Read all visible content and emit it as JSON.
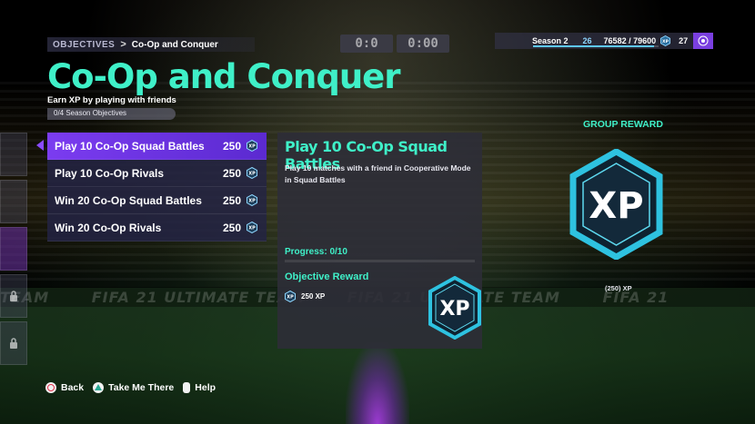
{
  "breadcrumb": {
    "parent": "OBJECTIVES",
    "separator": ">",
    "current": "Co-Op and Conquer"
  },
  "scoreboard": {
    "left_score": "0:0",
    "right_clock": "0:00"
  },
  "status": {
    "season_label": "Season 2",
    "season_level": "26",
    "xp_total": "76582 / 79600",
    "xp_progress": 0.962,
    "level_number": "27"
  },
  "header": {
    "title": "Co-Op and Conquer",
    "subtitle": "Earn XP by playing with friends",
    "season_objectives": "0/4 Season Objectives",
    "season_objectives_progress": 0
  },
  "objectives": [
    {
      "label": "Play 10 Co-Op Squad Battles",
      "points": "250",
      "selected": true
    },
    {
      "label": "Play 10 Co-Op Rivals",
      "points": "250",
      "selected": false
    },
    {
      "label": "Win 20 Co-Op Squad Battles",
      "points": "250",
      "selected": false
    },
    {
      "label": "Win 20 Co-Op Rivals",
      "points": "250",
      "selected": false
    }
  ],
  "detail": {
    "title": "Play 10 Co-Op Squad Battles",
    "description": "Play 10 matches with a friend in Cooperative Mode in Squad Battles",
    "progress": "Progress: 0/10",
    "progress_value": 0,
    "reward_heading": "Objective Reward",
    "reward_value": "250 XP",
    "badge_text": "XP"
  },
  "group_reward": {
    "heading": "GROUP REWARD",
    "badge_text": "XP",
    "value": "(250) XP"
  },
  "ad_strip": [
    "TEAM",
    "FIFA 21 ULTIMATE TEAM",
    "FIFA 21 ULTIMATE TEAM",
    "FIFA 21"
  ],
  "controls": [
    {
      "label": "Back",
      "glyph": "circle-button-icon"
    },
    {
      "label": "Take Me There",
      "glyph": "triangle-button-icon"
    },
    {
      "label": "Help",
      "glyph": "options-button-icon"
    }
  ],
  "colors": {
    "accent": "#3ff0c8",
    "selected": "#7b3cf0",
    "xp_blue": "#5ec8ff"
  }
}
